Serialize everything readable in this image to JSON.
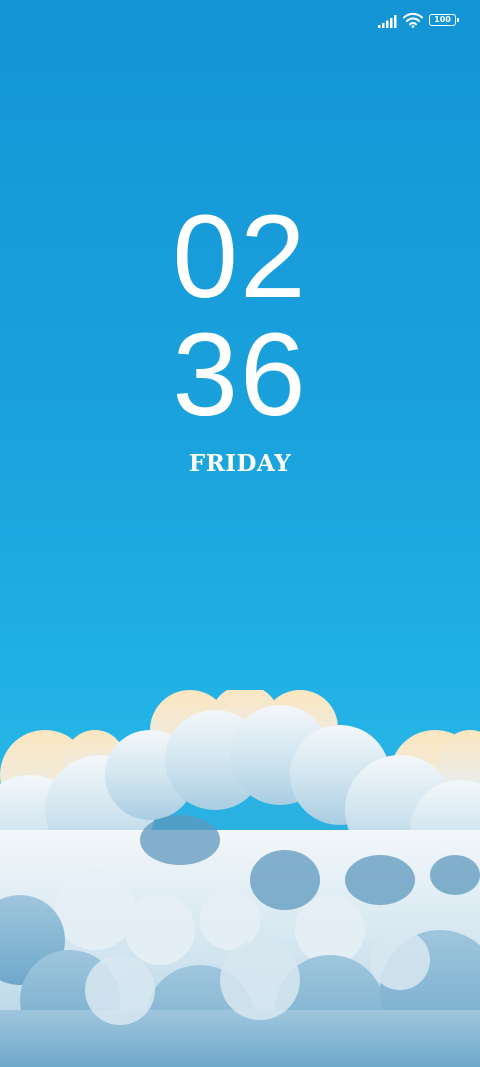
{
  "status_bar": {
    "battery_level": "100",
    "icons": [
      "signal-icon",
      "wifi-icon",
      "battery-icon"
    ]
  },
  "lock_screen": {
    "hours": "02",
    "minutes": "36",
    "day": "FRIDAY"
  },
  "colors": {
    "sky_top": "#1495d6",
    "sky_bottom": "#26b4e6",
    "cloud_white": "#eef6fb",
    "cloud_warm": "#f6e7c6",
    "cloud_shadow": "#4f8fb5"
  }
}
